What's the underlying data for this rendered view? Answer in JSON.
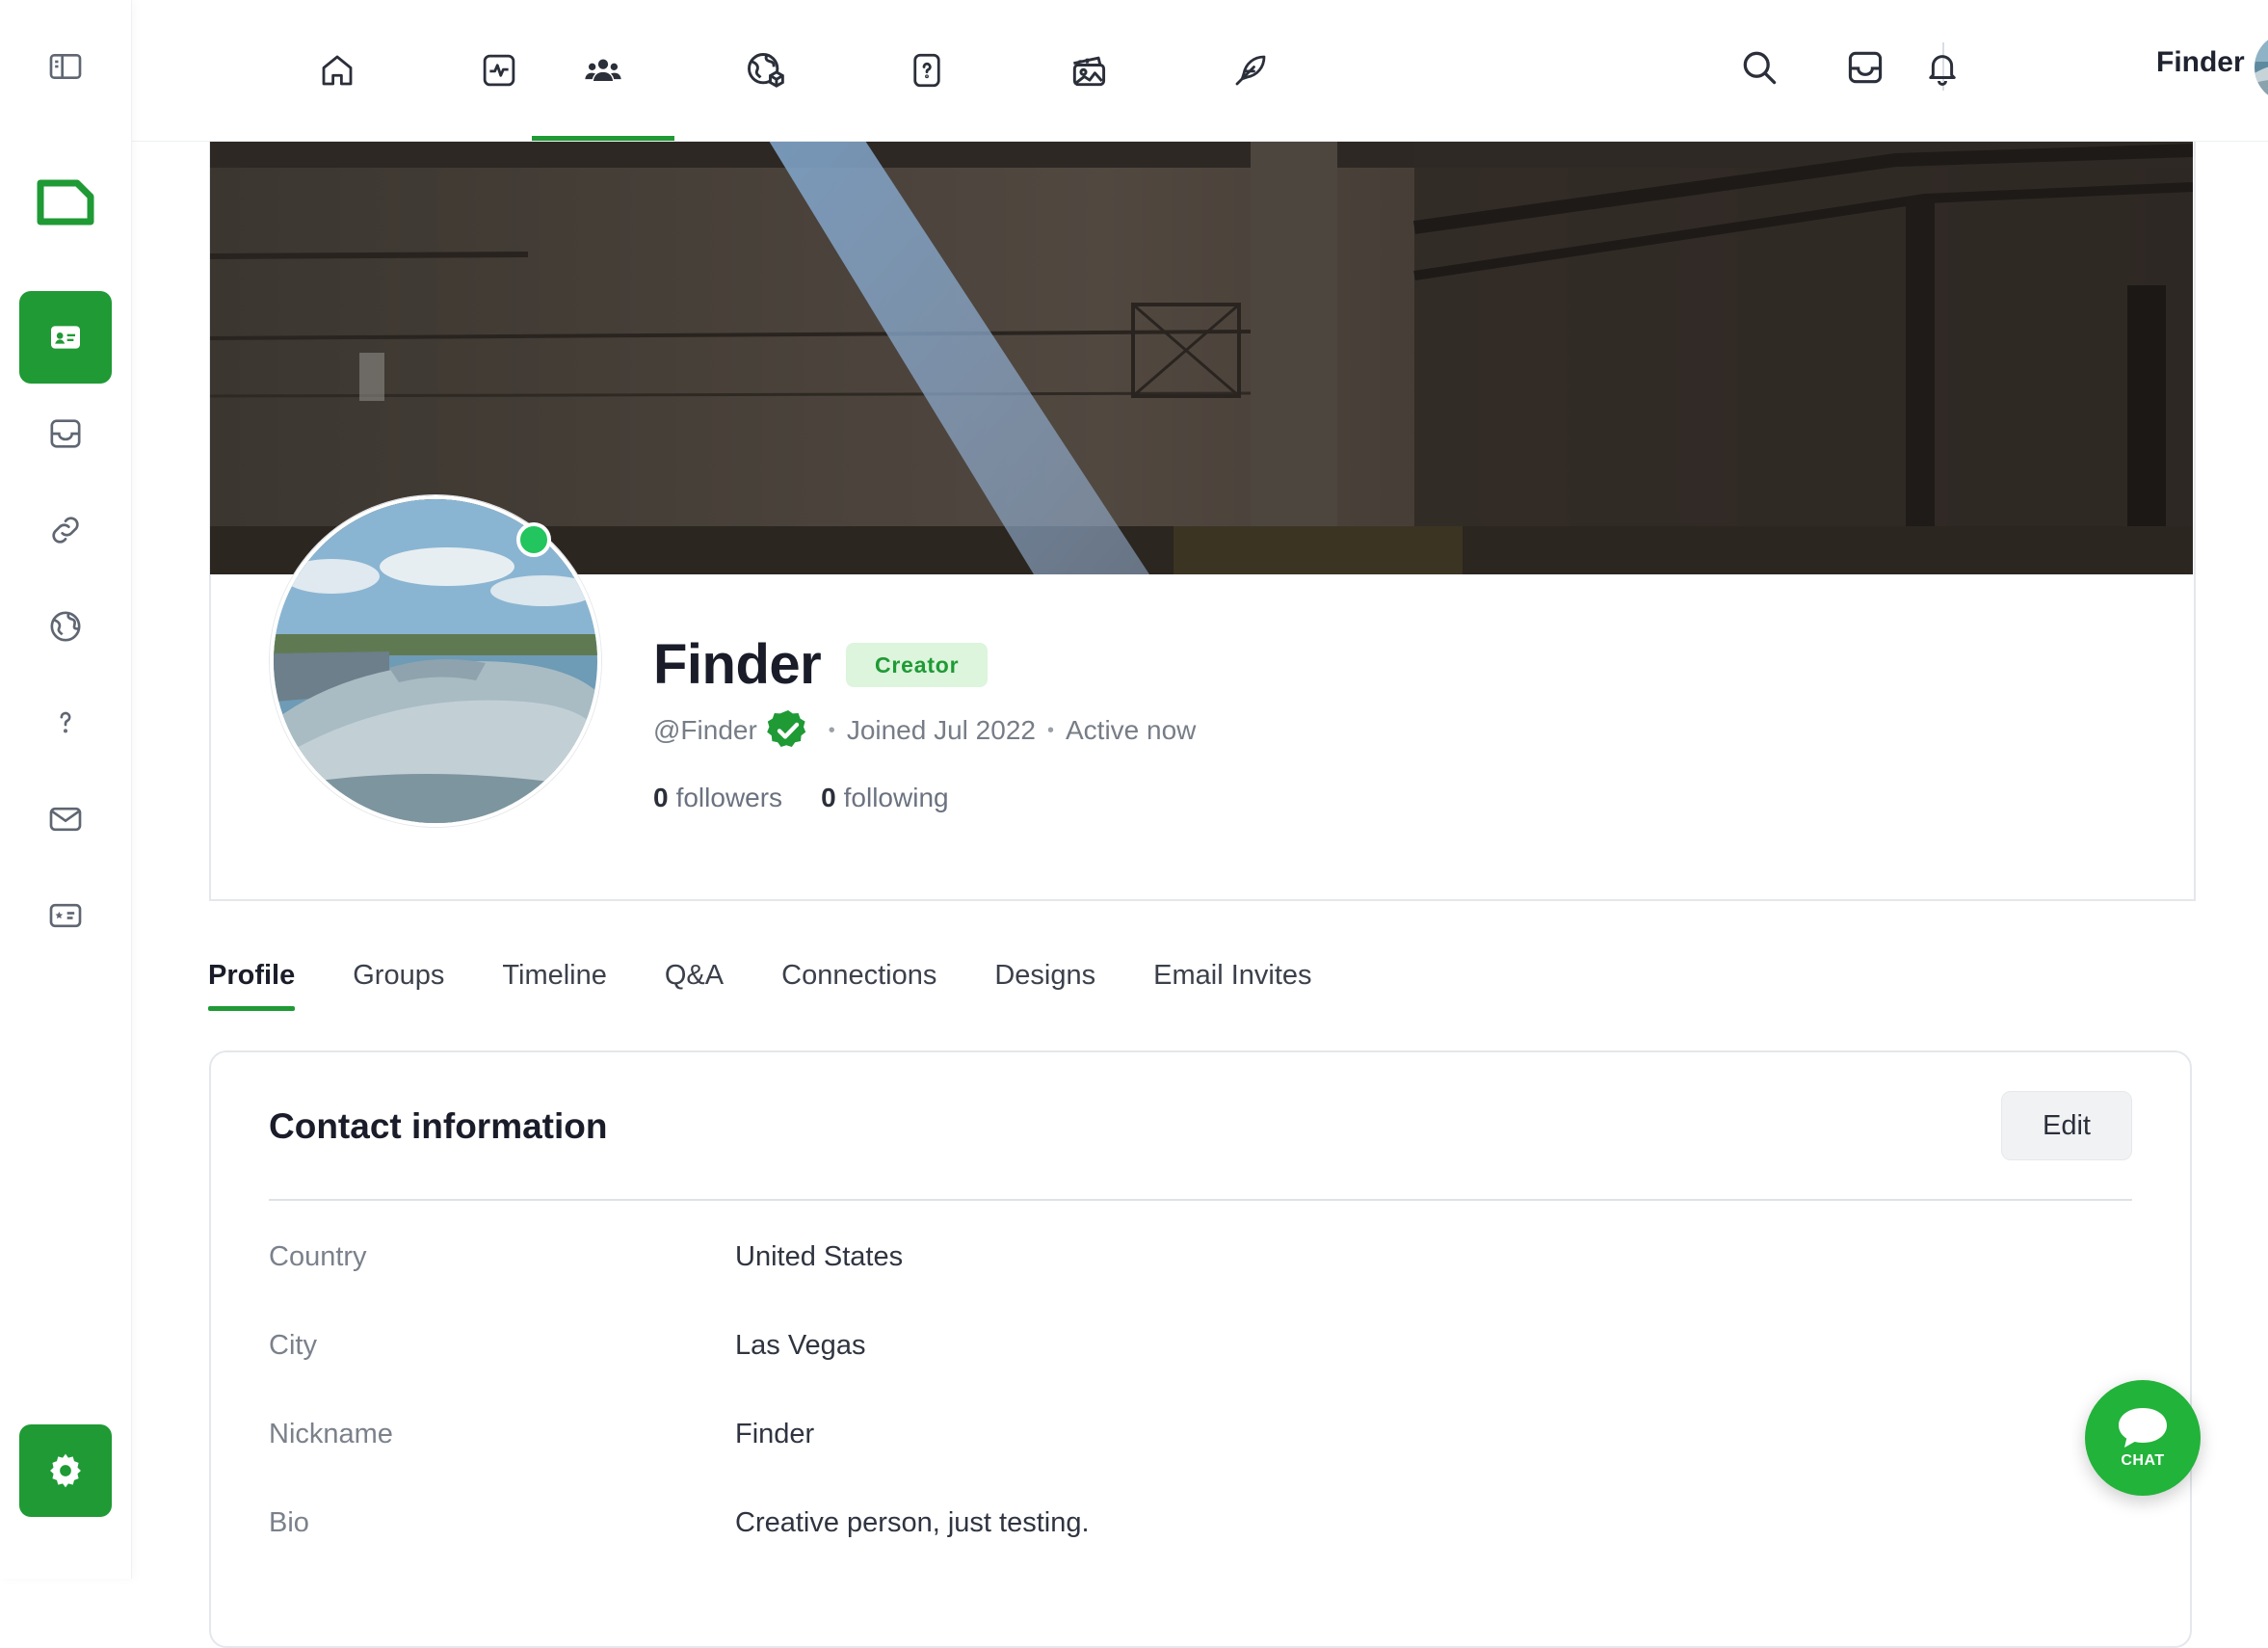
{
  "topbar": {
    "user_name": "Finder",
    "tabs": [
      {
        "icon": "home-icon"
      },
      {
        "icon": "activity-icon"
      },
      {
        "icon": "members-icon"
      },
      {
        "icon": "globe-icon"
      },
      {
        "icon": "question-icon"
      },
      {
        "icon": "gallery-icon"
      },
      {
        "icon": "feather-icon"
      }
    ],
    "actions": [
      "search-icon",
      "inbox-icon",
      "bell-icon"
    ]
  },
  "sidebar": {
    "items": [
      {
        "icon": "sidebar-toggle-icon"
      },
      {
        "icon": "logo-icon"
      },
      {
        "icon": "id-card-icon",
        "active": true
      },
      {
        "icon": "inbox-icon"
      },
      {
        "icon": "link-icon"
      },
      {
        "icon": "globe-icon"
      },
      {
        "icon": "question-icon"
      },
      {
        "icon": "mail-icon"
      },
      {
        "icon": "star-card-icon"
      },
      {
        "icon": "gear-icon"
      }
    ]
  },
  "profile": {
    "name": "Finder",
    "badge": "Creator",
    "handle": "@Finder",
    "joined": "Joined Jul 2022",
    "status": "Active now",
    "followers_count": "0",
    "followers_label": "followers",
    "following_count": "0",
    "following_label": "following"
  },
  "tabs": {
    "items": [
      "Profile",
      "Groups",
      "Timeline",
      "Q&A",
      "Connections",
      "Designs",
      "Email Invites"
    ],
    "active": "Profile"
  },
  "contact": {
    "title": "Contact information",
    "edit_label": "Edit",
    "rows": [
      {
        "label": "Country",
        "value": "United States"
      },
      {
        "label": "City",
        "value": "Las Vegas"
      },
      {
        "label": "Nickname",
        "value": "Finder"
      },
      {
        "label": "Bio",
        "value": "Creative person, just testing."
      }
    ]
  },
  "chat": {
    "label": "CHAT"
  },
  "colors": {
    "accent": "#1f9a35",
    "online": "#22c55e",
    "badge_bg": "#dcf5dc"
  }
}
